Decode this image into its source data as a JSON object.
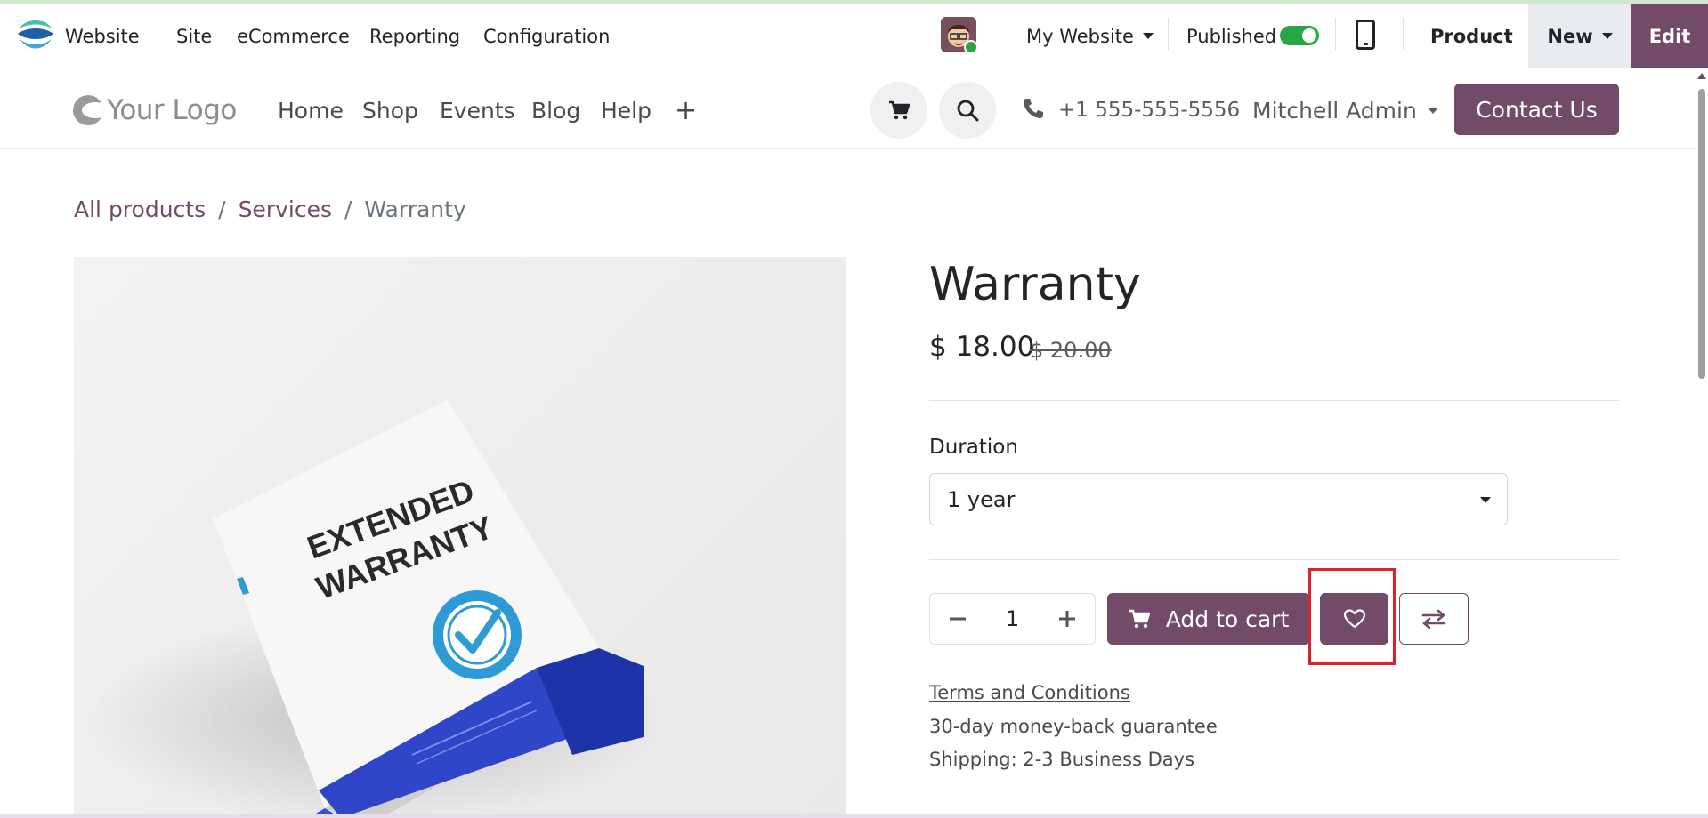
{
  "odoo_bar": {
    "app_name": "Website",
    "menu": [
      "Site",
      "eCommerce",
      "Reporting",
      "Configuration"
    ],
    "website_selector": "My Website",
    "published_label": "Published",
    "published": true,
    "product_label": "Product",
    "new_label": "New",
    "edit_label": "Edit"
  },
  "site_header": {
    "logo_text": "Your Logo",
    "nav": [
      "Home",
      "Shop",
      "Events",
      "Blog",
      "Help"
    ],
    "add_menu": "+",
    "phone": "+1 555-555-5556",
    "user": "Mitchell Admin",
    "contact_button": "Contact Us"
  },
  "breadcrumb": {
    "items": [
      "All products",
      "Services",
      "Warranty"
    ],
    "separator": "/"
  },
  "product": {
    "name": "Warranty",
    "price": "$ 18.00",
    "price_old": "$ 20.00",
    "attribute_label": "Duration",
    "attribute_value": "1 year",
    "quantity": "1",
    "add_to_cart": "Add to cart",
    "terms_link": "Terms and Conditions",
    "guarantee": "30-day money-back guarantee",
    "shipping": "Shipping: 2-3 Business Days",
    "image_text_line1": "EXTENDED",
    "image_text_line2": "WARRANTY"
  },
  "colors": {
    "brand": "#714b67",
    "toggle_on": "#28a745",
    "highlight": "#d9232d"
  },
  "icons": [
    "app-logo-icon",
    "caret-down-icon",
    "mobile-preview-icon",
    "cart-icon",
    "search-icon",
    "phone-icon",
    "minus-icon",
    "plus-icon",
    "heart-icon",
    "compare-icon"
  ]
}
